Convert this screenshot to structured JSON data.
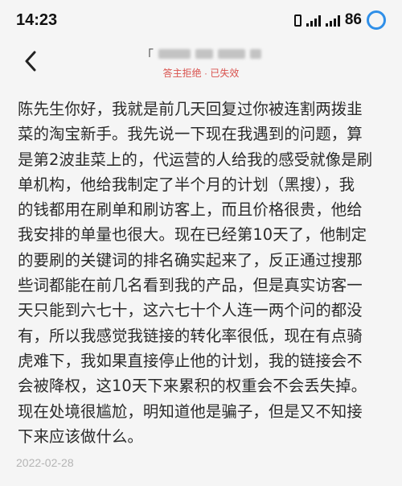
{
  "status_bar": {
    "time": "14:23",
    "battery": "86",
    "icons": [
      "vibrate-icon",
      "signal-icon",
      "signal-icon",
      "battery-ring-icon"
    ],
    "accent_color": "#2f8fe8"
  },
  "header": {
    "back_icon": "chevron-left-icon",
    "title_blurred": "「",
    "subtitle": "答主拒绝 · 已失效",
    "subtitle_color": "#d9534f"
  },
  "message": {
    "lines": [
      "陈先生你好，我就是前几天回复过你被连割两拨韭",
      "菜的淘宝新手。我先说一下现在我遇到的问题，算",
      "是第2波韭菜上的，代运营的人给我的感受就像是刷",
      "单机构，他给我制定了半个月的计划（黑搜），我",
      "的钱都用在刷单和刷访客上，而且价格很贵，他给",
      "我安排的单量也很大。现在已经第10天了，他制定",
      "的要刷的关键词的排名确实起来了，反正通过搜那",
      "些词都能在前几名看到我的产品，但是真实访客一",
      "天只能到六七十，这六七十个人连一两个问的都没",
      "有，所以我感觉我链接的转化率很低，现在有点骑",
      "虎难下，我如果直接停止他的计划，我的链接会不",
      "会被降权，这10天下来累积的权重会不会丢失掉。",
      "现在处境很尴尬，明知道他是骗子，但是又不知接",
      "下来应该做什么。"
    ],
    "date": "2022-02-28"
  }
}
